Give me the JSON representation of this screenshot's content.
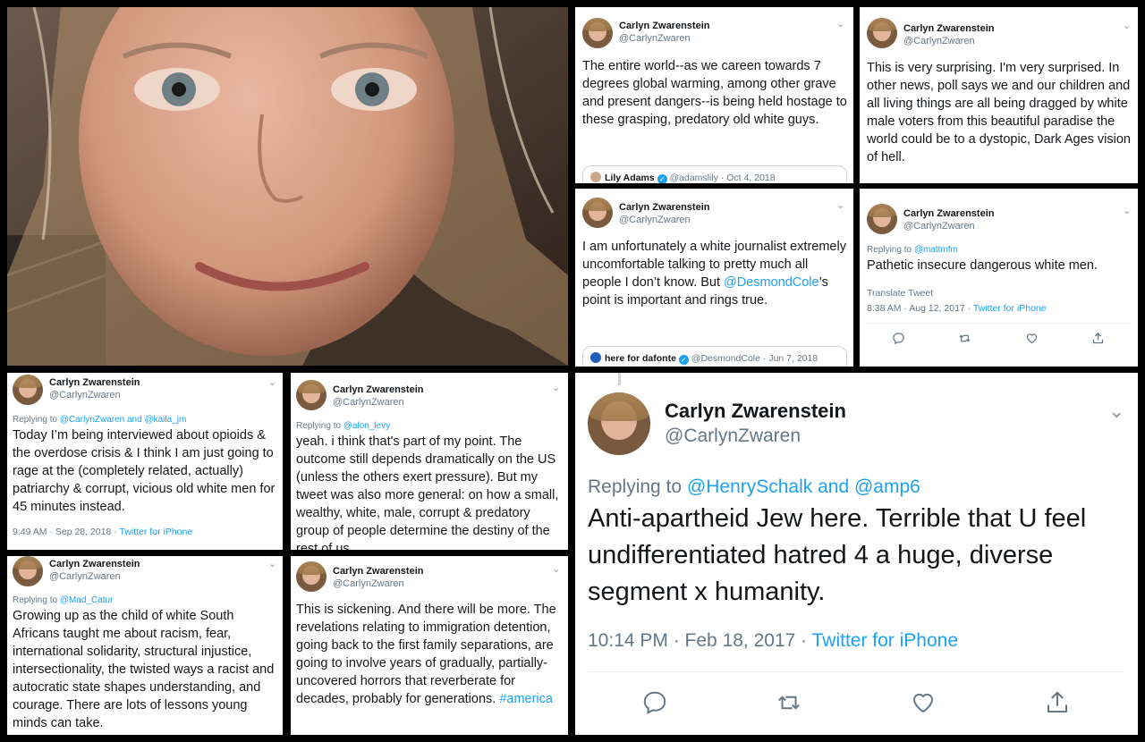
{
  "tweets": {
    "t1": {
      "name": "Carlyn Zwarenstein",
      "handle": "@CarlynZwaren",
      "chevron": "⌄",
      "text": "The entire world--as we careen towards 7 degrees global warming, among other grave and present dangers--is being held hostage to these grasping, predatory old white guys.",
      "quote_name": "Lily Adams",
      "quote_handle": "@adamslily",
      "quote_date": "· Oct 4, 2018"
    },
    "t2": {
      "name": "Carlyn Zwarenstein",
      "handle": "@CarlynZwaren",
      "chevron": "⌄",
      "text": "This is very surprising. I'm very surprised. In other news, poll says we and our children and all living things are all being dragged by white male voters from this beautiful paradise the world could be to a dystopic, Dark Ages vision of hell."
    },
    "t3": {
      "name": "Carlyn Zwarenstein",
      "handle": "@CarlynZwaren",
      "chevron": "⌄",
      "text_a": "I am unfortunately a white journalist extremely uncomfortable talking to pretty much all people I don’t know. But ",
      "mention": "@DesmondCole",
      "text_b": "’s point is important and rings true.",
      "quote_name": "here for dafonte",
      "quote_handle": "@DesmondCole",
      "quote_date": "· Jun 7, 2018"
    },
    "t4": {
      "name": "Carlyn Zwarenstein",
      "handle": "@CarlynZwaren",
      "chevron": "⌄",
      "replying_prefix": "Replying to ",
      "replying_to": "@mattmfm",
      "text": "Pathetic insecure dangerous white men.",
      "translate": "Translate Tweet",
      "time": "8:38 AM · Aug 12, 2017 · ",
      "source": "Twitter for iPhone"
    },
    "t5": {
      "name": "Carlyn Zwarenstein",
      "handle": "@CarlynZwaren",
      "chevron": "⌄",
      "replying_prefix": "Replying to ",
      "replying_to": "@CarlynZwaren and @kaila_jm",
      "text": "Today I’m being interviewed about opioids & the overdose crisis & I think I am just going to rage at the (completely related, actually) patriarchy & corrupt, vicious old white men for 45 minutes instead.",
      "time": "9:49 AM · Sep 28, 2018 · ",
      "source": "Twitter for iPhone"
    },
    "t6": {
      "name": "Carlyn Zwarenstein",
      "handle": "@CarlynZwaren",
      "chevron": "⌄",
      "replying_prefix": "Replying to ",
      "replying_to": "@alon_levy",
      "text": "yeah. i think that's part of my point. The outcome still depends dramatically on the US (unless the others exert pressure). But my tweet was also more general: on how a small, wealthy, white, male, corrupt & predatory group of people determine the destiny of the rest of us."
    },
    "t7": {
      "name": "Carlyn Zwarenstein",
      "handle": "@CarlynZwaren",
      "chevron": "⌄",
      "replying_prefix": "Replying to ",
      "replying_to": "@Mad_Catur",
      "text": "Growing up as the child of white South Africans taught me about racism, fear, international solidarity, structural injustice, intersectionality, the twisted ways a racist and autocratic state shapes understanding, and courage. There are lots of lessons young minds can take."
    },
    "t8": {
      "name": "Carlyn Zwarenstein",
      "handle": "@CarlynZwaren",
      "chevron": "⌄",
      "text": "This is sickening. And there will be more. The revelations relating to immigration detention, going back to the first family separations, are going to involve years of gradually, partially-uncovered horrors that reverberate for decades, probably for generations. ",
      "hashtag": "#america"
    },
    "t9": {
      "name": "Carlyn Zwarenstein",
      "handle": "@CarlynZwaren",
      "chevron": "⌄",
      "replying_prefix": "Replying to ",
      "replying_to": "@HenrySchalk and @amp6",
      "text": "Anti-apartheid Jew here. Terrible that U feel undifferentiated hatred 4 a huge, diverse segment x humanity.",
      "time": "10:14 PM · Feb 18, 2017 · ",
      "source": "Twitter for iPhone"
    }
  },
  "icons": [
    "reply-icon",
    "retweet-icon",
    "like-icon",
    "share-icon"
  ],
  "colors": {
    "link": "#1da1f2",
    "text": "#14171a",
    "secondary": "#657786",
    "background": "#000000"
  }
}
